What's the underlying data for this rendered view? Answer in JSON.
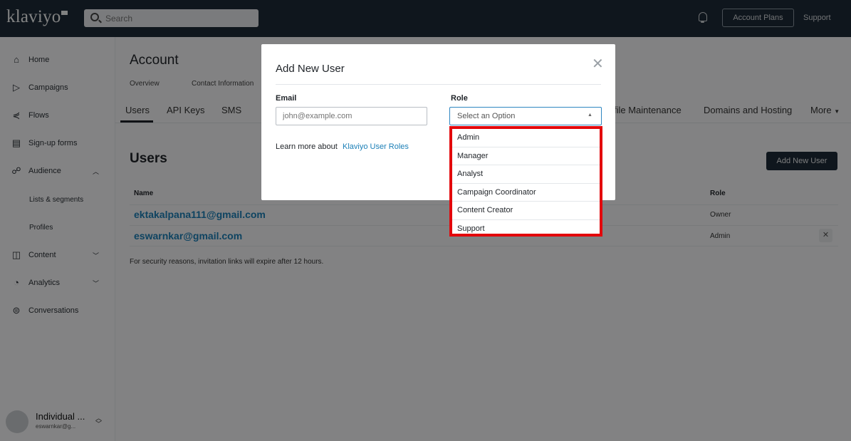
{
  "topbar": {
    "logo": "klaviyo",
    "search_placeholder": "Search",
    "account_plans": "Account Plans",
    "support": "Support"
  },
  "sidebar": {
    "items": [
      {
        "label": "Home",
        "icon": "home-icon"
      },
      {
        "label": "Campaigns",
        "icon": "send-icon"
      },
      {
        "label": "Flows",
        "icon": "flows-icon"
      },
      {
        "label": "Sign-up forms",
        "icon": "form-icon"
      },
      {
        "label": "Audience",
        "icon": "people-icon"
      },
      {
        "label": "Content",
        "icon": "content-icon"
      },
      {
        "label": "Analytics",
        "icon": "analytics-icon"
      },
      {
        "label": "Conversations",
        "icon": "chat-icon"
      }
    ],
    "audience_sub": [
      "Lists & segments",
      "Profiles"
    ],
    "account_name": "Individual ...",
    "account_email": "eswarnkar@g..."
  },
  "page": {
    "title": "Account",
    "sub_tabs": [
      "Overview",
      "Contact Information"
    ],
    "tabs": [
      "Users",
      "API Keys",
      "SMS"
    ],
    "tabs_right": [
      "file Maintenance",
      "Domains and Hosting",
      "More"
    ],
    "users_heading": "Users",
    "add_new_user": "Add New User",
    "col_name": "Name",
    "col_role": "Role",
    "users": [
      {
        "email": "ektakalpana111@gmail.com",
        "role": "Owner"
      },
      {
        "email": "eswarnkar@gmail.com",
        "role": "Admin"
      }
    ],
    "note": "For security reasons, invitation links will expire after 12 hours."
  },
  "modal": {
    "title": "Add New User",
    "email_label": "Email",
    "email_placeholder": "john@example.com",
    "role_label": "Role",
    "role_placeholder": "Select an Option",
    "learn_text": "Learn more about",
    "learn_link": "Klaviyo User Roles",
    "role_options": [
      "Admin",
      "Manager",
      "Analyst",
      "Campaign Coordinator",
      "Content Creator",
      "Support"
    ]
  },
  "colors": {
    "topbar": "#1e2a37",
    "link": "#1b7fb7",
    "highlight": "#e3060b",
    "select_focus": "#2e86c1"
  }
}
